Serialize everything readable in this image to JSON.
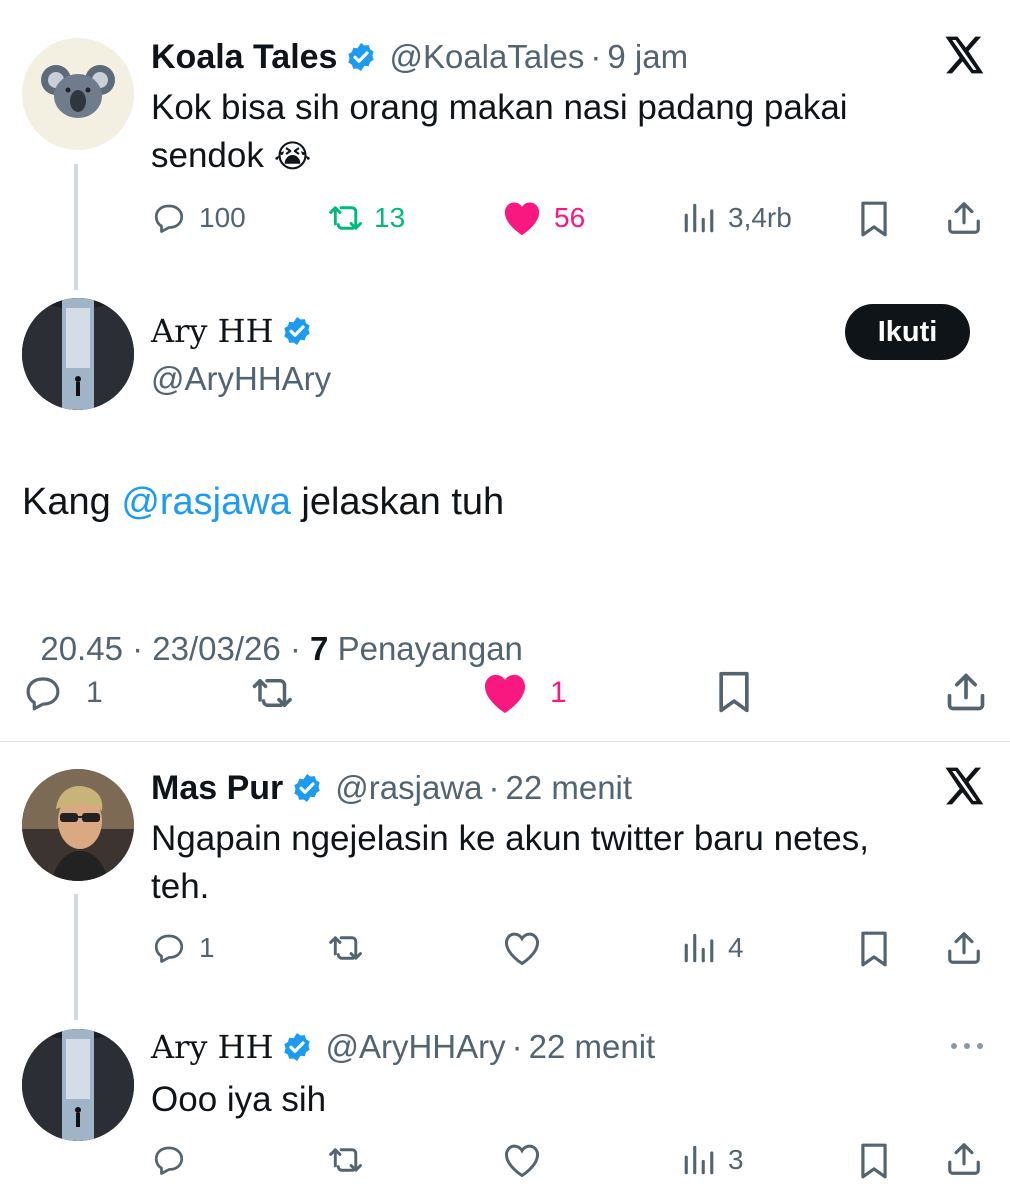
{
  "tweet1": {
    "name": "Koala Tales",
    "handle": "@KoalaTales",
    "time": "9 jam",
    "text_line1": "Kok bisa sih orang makan nasi padang pakai",
    "text_line2": "sendok",
    "emoji": "😭",
    "replies": "100",
    "retweets": "13",
    "likes": "56",
    "views": "3,4rb"
  },
  "main": {
    "name": "Ary HH",
    "handle": "@AryHHAry",
    "follow_label": "Ikuti",
    "text_prefix": "Kang ",
    "mention": "@rasjawa",
    "text_suffix": " jelaskan tuh",
    "timestamp": "20.45 · 23/03/26 · ",
    "view_count": "7",
    "view_label": " Penayangan",
    "replies": "1",
    "likes": "1"
  },
  "reply1": {
    "name": "Mas Pur",
    "handle": "@rasjawa",
    "time": "22 menit",
    "text_line1": "Ngapain ngejelasin ke akun twitter baru netes,",
    "text_line2": "teh.",
    "replies": "1",
    "views": "4"
  },
  "reply2": {
    "name": "Ary HH",
    "handle": "@AryHHAry",
    "time": "22 menit",
    "text": "Ooo iya sih",
    "views": "3"
  },
  "colors": {
    "retweet_green": "#00ba7c",
    "like_pink": "#f91880",
    "verified_blue": "#1d9bf0",
    "text_gray": "#536471"
  }
}
